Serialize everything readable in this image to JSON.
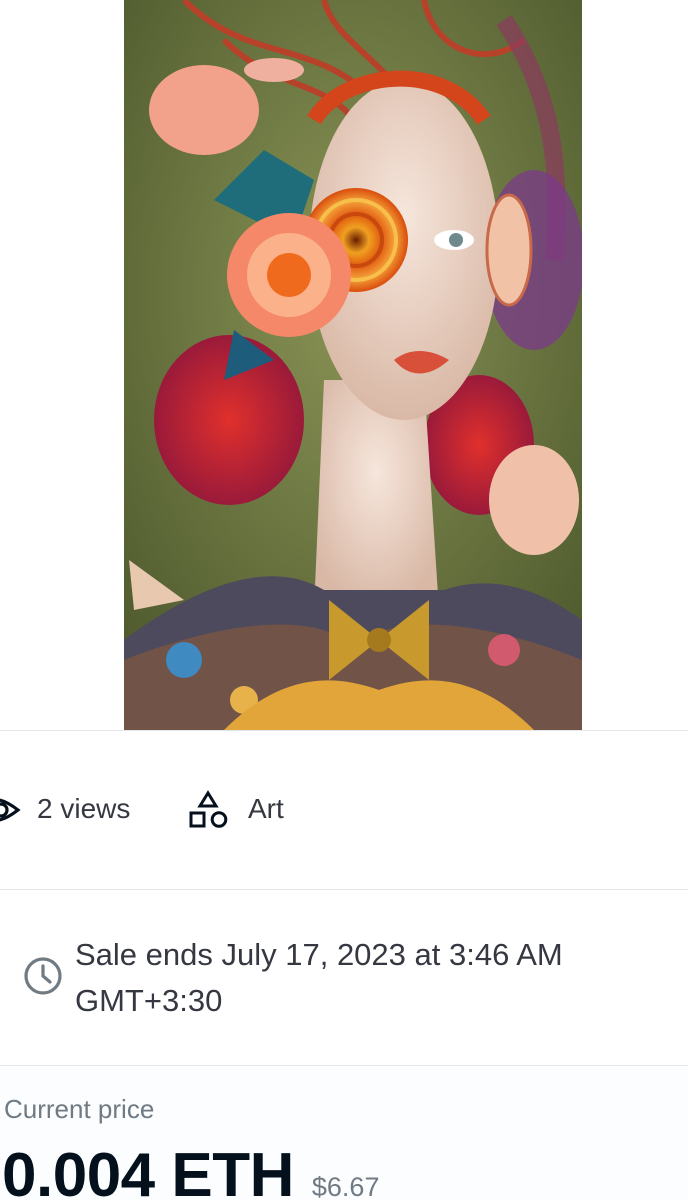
{
  "asset": {
    "image_alt": "Surreal portrait of a woman with flowers and a spiral over one eye"
  },
  "meta": {
    "views_icon": "eye-icon",
    "views_label": "2 views",
    "category_icon": "shapes-icon",
    "category_label": "Art"
  },
  "sale": {
    "icon": "clock-icon",
    "ends_text": "Sale ends July 17, 2023 at 3:46 AM GMT+3:30"
  },
  "price": {
    "caption": "Current price",
    "amount": "0.004 ETH",
    "fiat": "$6.67"
  },
  "colors": {
    "text_primary": "#04111d",
    "text_secondary": "#707a83",
    "divider": "#e5e8eb",
    "panel_bg": "#fbfdff"
  }
}
